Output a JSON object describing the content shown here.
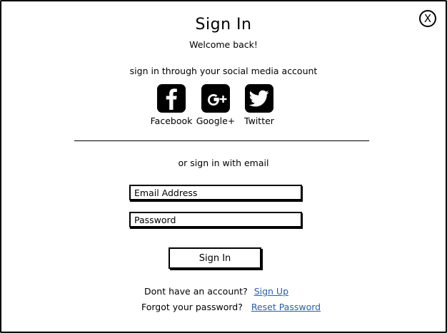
{
  "dialog": {
    "title": "Sign In",
    "subtitle": "Welcome back!",
    "close_icon_text": "X"
  },
  "social": {
    "prompt": "sign in through your social media account",
    "buttons": [
      {
        "label": "Facebook",
        "icon": "facebook-icon"
      },
      {
        "label": "Google+",
        "icon": "google-plus-icon"
      },
      {
        "label": "Twitter",
        "icon": "twitter-icon"
      }
    ]
  },
  "email": {
    "prompt": "or sign in with email",
    "email_placeholder": "Email Address",
    "password_placeholder": "Password",
    "submit_label": "Sign In"
  },
  "footer": {
    "signup_prompt": "Dont have an account?",
    "signup_link": "Sign Up",
    "reset_prompt": "Forgot your password?",
    "reset_link": "Reset Password"
  },
  "colors": {
    "link": "#2a5ea8",
    "icon_tile": "#000000"
  }
}
